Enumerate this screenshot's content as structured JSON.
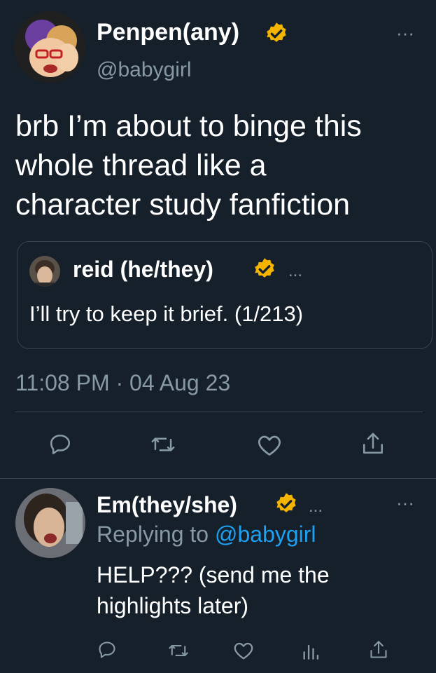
{
  "main_tweet": {
    "display_name": "Penpen(any)",
    "handle": "@babygirl",
    "text_line1": "brb I’m about to binge this",
    "text_line2": "whole thread like a",
    "text_line3": "character study fanfiction",
    "timestamp": "11:08 PM · 04 Aug 23",
    "more_label": "···"
  },
  "quoted_tweet": {
    "display_name": "reid (he/they)",
    "extra": "...",
    "text": "I’ll try to keep it brief. (1/213)"
  },
  "reply": {
    "display_name": "Em(they/she)",
    "extra": "...",
    "replying_prefix": "Replying to",
    "replying_handle": "@babygirl",
    "text_line1": "HELP??? (send me the",
    "text_line2": "highlights later)",
    "more_label": "···"
  },
  "icons": [
    "reply-icon",
    "retweet-icon",
    "like-icon",
    "share-icon",
    "analytics-icon",
    "verified-icon"
  ],
  "colors": {
    "background": "#15202b",
    "text": "#ffffff",
    "muted": "#8899a6",
    "link": "#1da1f2",
    "verified": "#f4b400",
    "divider": "#38444d"
  }
}
